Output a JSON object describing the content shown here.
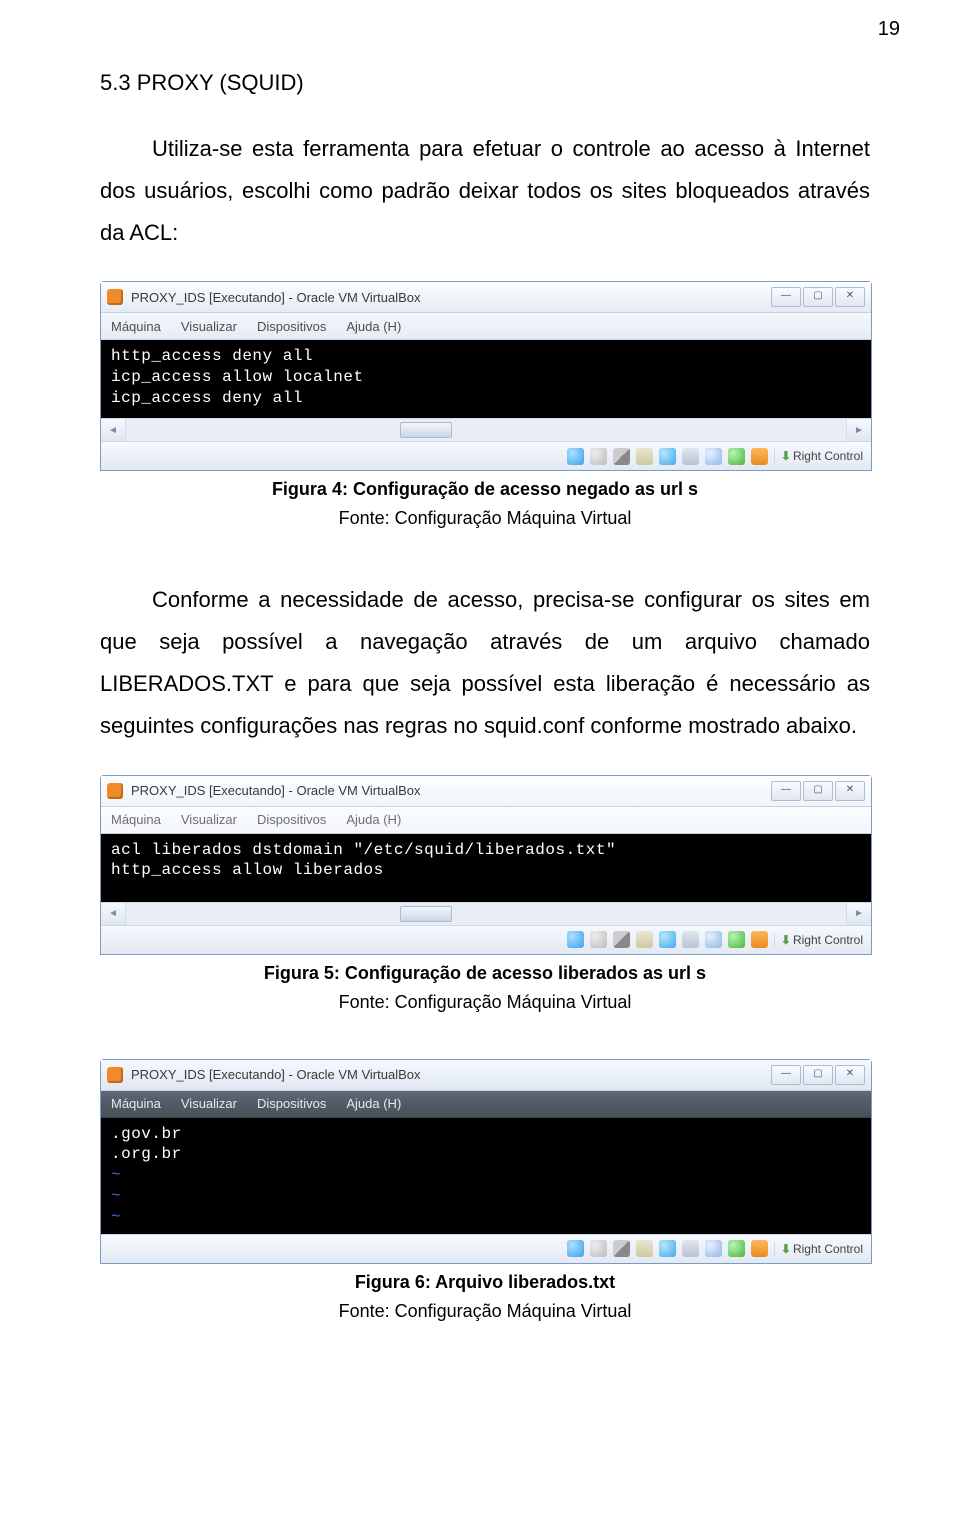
{
  "page_number": "19",
  "section_title": "5.3 PROXY (SQUID)",
  "para1": "Utiliza-se esta ferramenta para efetuar o controle ao acesso à Internet dos usuários, escolhi como padrão deixar todos os sites bloqueados através da ACL:",
  "para2": "Conforme a necessidade de acesso, precisa-se configurar os sites em que seja possível a navegação através de um arquivo chamado LIBERADOS.TXT e para que seja possível esta liberação é necessário as seguintes configurações nas regras no squid.conf conforme mostrado abaixo.",
  "captions": {
    "fig4": "Figura 4: Configuração de acesso negado as url s",
    "fig4_src": "Fonte: Configuração Máquina Virtual",
    "fig5": "Figura 5: Configuração de acesso liberados as url s",
    "fig5_src": "Fonte: Configuração Máquina Virtual",
    "fig6": "Figura 6: Arquivo liberados.txt",
    "fig6_src": "Fonte: Configuração Máquina Virtual"
  },
  "vbox": {
    "title": "PROXY_IDS [Executando] - Oracle VM VirtualBox",
    "menu": {
      "m1": "Máquina",
      "m2": "Visualizar",
      "m3": "Dispositivos",
      "m4": "Ajuda (H)"
    },
    "status_label": "Right Control",
    "win_min": "—",
    "win_max": "▢",
    "win_close": "✕"
  },
  "terminals": {
    "t1_l1": "http_access deny all",
    "t1_l2": "icp_access allow localnet",
    "t1_l3": "icp_access deny all",
    "t2_l1": "acl liberados dstdomain \"/etc/squid/liberados.txt\"",
    "t2_l2": "http_access allow liberados",
    "t3_l1": ".gov.br",
    "t3_l2": ".org.br",
    "t3_tilde": "~"
  }
}
